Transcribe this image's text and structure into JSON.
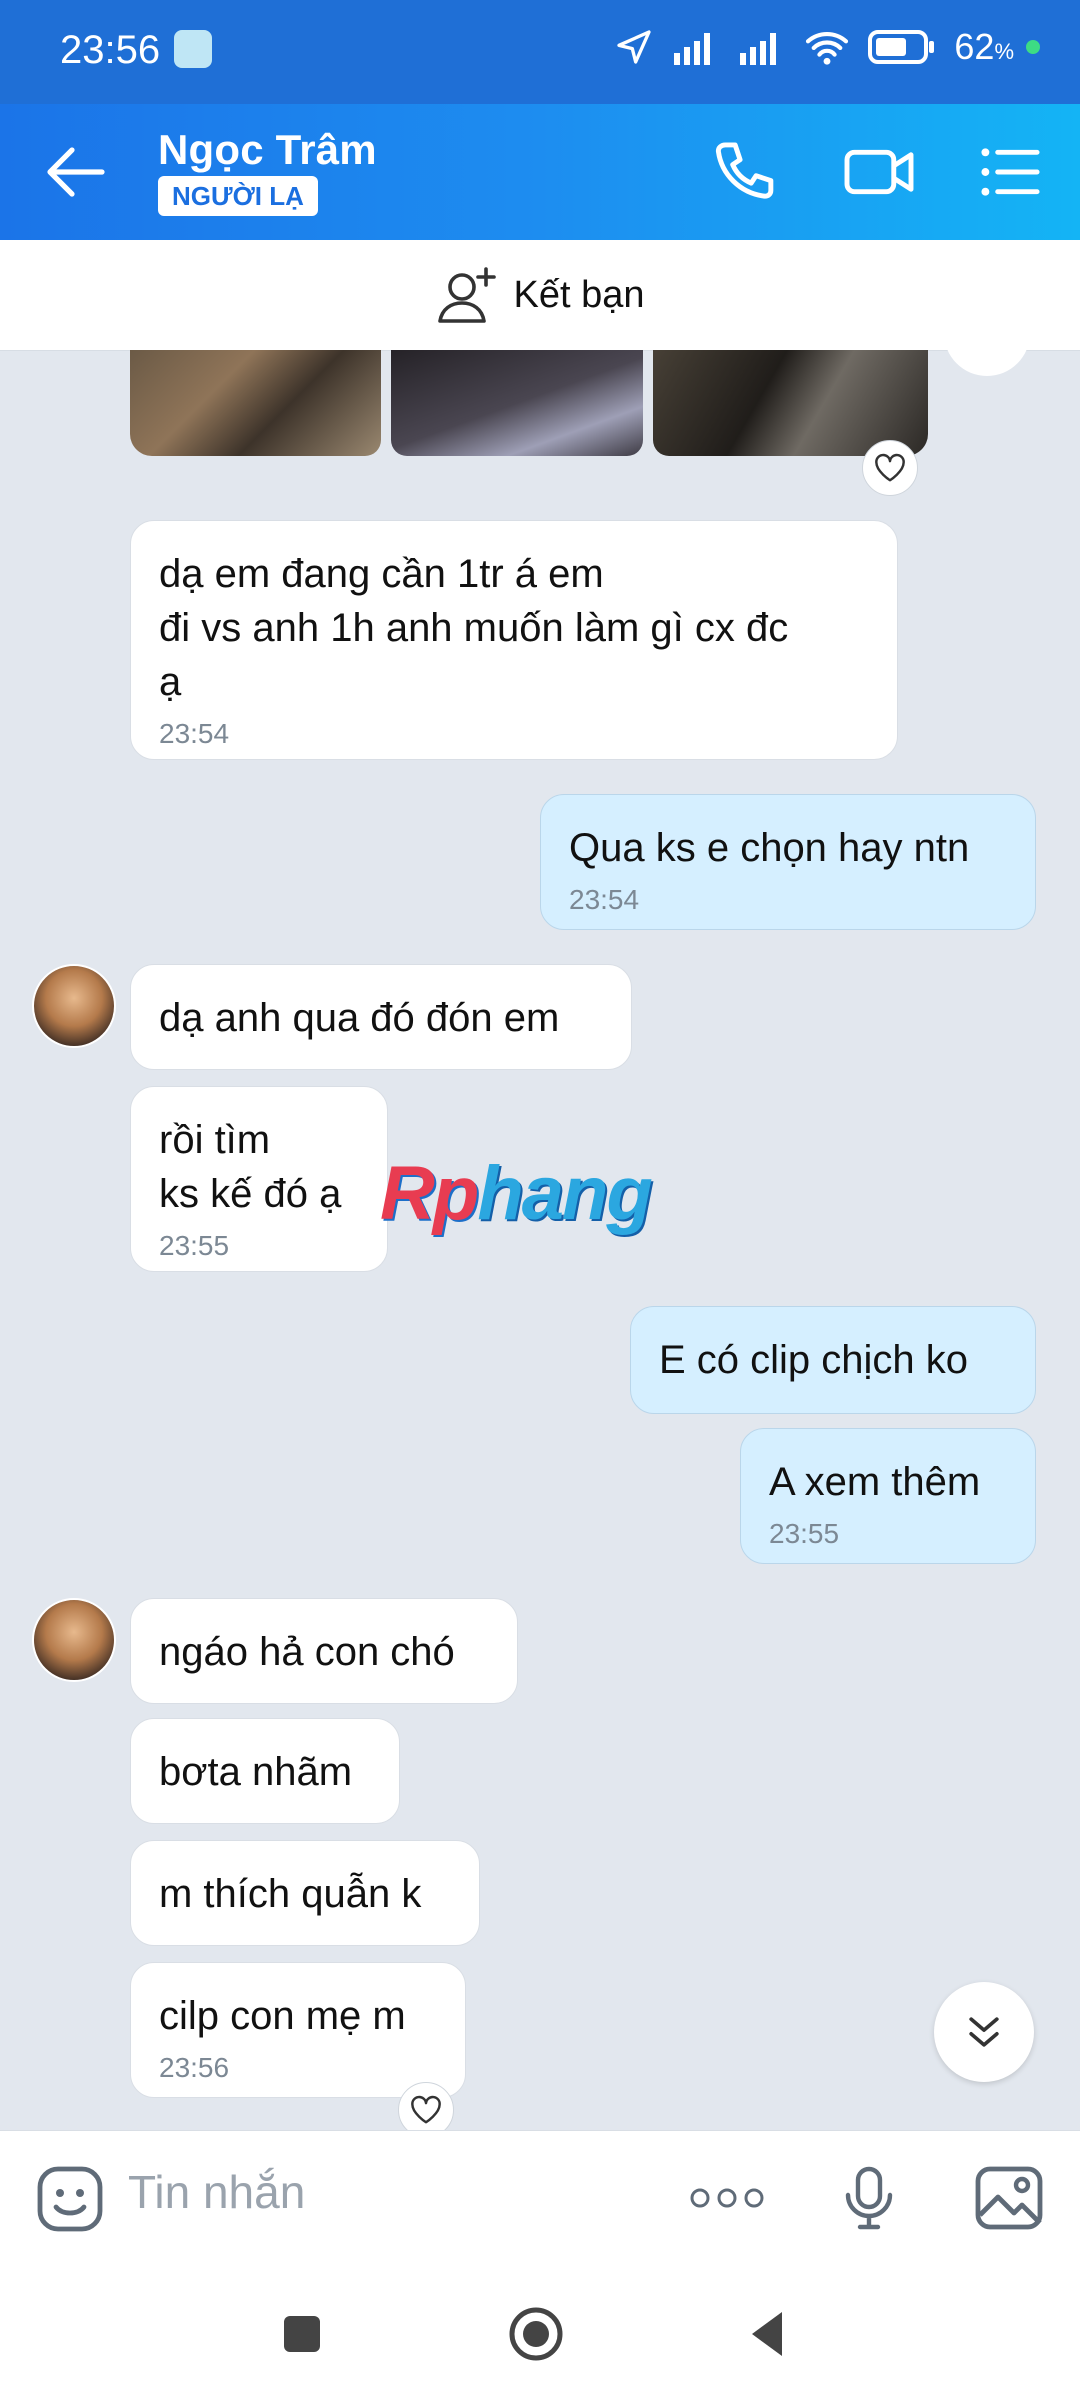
{
  "status_bar": {
    "time": "23:56",
    "battery": "62",
    "battery_unit": "%"
  },
  "header": {
    "contact_name": "Ngọc Trâm",
    "badge": "NGƯỜI LẠ"
  },
  "friend_bar": {
    "label": "Kết bạn"
  },
  "messages": [
    {
      "side": "in",
      "lines": [
        "dạ em đang cần 1tr á em",
        "đi vs anh 1h anh muốn làm gì cx đc",
        "ạ"
      ],
      "time": "23:54"
    },
    {
      "side": "out",
      "lines": [
        "Qua ks e chọn hay ntn"
      ],
      "time": "23:54"
    },
    {
      "side": "in",
      "lines": [
        "dạ anh qua đó đón em"
      ]
    },
    {
      "side": "in",
      "lines": [
        "rồi tìm",
        "ks kế đó ạ"
      ],
      "time": "23:55"
    },
    {
      "side": "out",
      "lines": [
        "E có clip chịch ko"
      ]
    },
    {
      "side": "out",
      "lines": [
        "A xem thêm"
      ],
      "time": "23:55"
    },
    {
      "side": "in",
      "lines": [
        "ngáo hả con chó"
      ]
    },
    {
      "side": "in",
      "lines": [
        "bơta nhãm"
      ]
    },
    {
      "side": "in",
      "lines": [
        "m thích quẫn k"
      ]
    },
    {
      "side": "in",
      "lines": [
        "cilp con mẹ m"
      ],
      "time": "23:56"
    }
  ],
  "watermark": {
    "part1": "Rp",
    "part2": "hang"
  },
  "composer": {
    "placeholder": "Tin nhắn"
  },
  "colors": {
    "header_start": "#1b74e8",
    "header_end": "#14b4f5",
    "out_bubble": "#d5efff",
    "in_bubble": "#ffffff",
    "chat_bg": "#e2e7ee"
  }
}
